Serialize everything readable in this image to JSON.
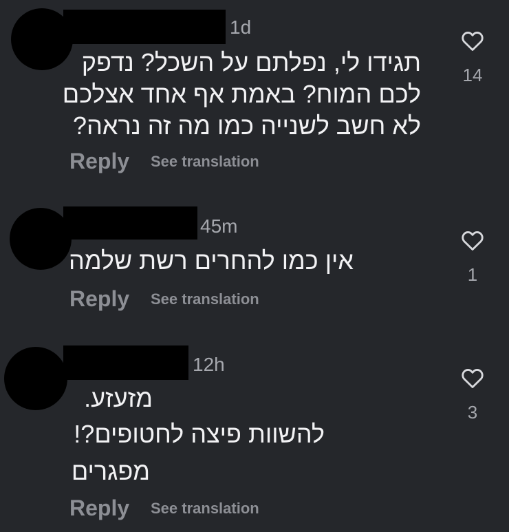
{
  "colors": {
    "background": "#25272b",
    "text": "#f2f2f4",
    "muted": "#8d8f95",
    "redaction": "#000000"
  },
  "comments": [
    {
      "time": "1d",
      "lines": [
        "תגידו לי, נפלתם על השכל? נדפק",
        "לכם המוח? באמת אף אחד אצלכם",
        "לא חשב לשנייה כמו מה זה נראה?"
      ],
      "reply": "Reply",
      "translate": "See translation",
      "likes": "14"
    },
    {
      "time": "45m",
      "lines": [
        "אין כמו להחרים רשת שלמה"
      ],
      "reply": "Reply",
      "translate": "See translation",
      "likes": "1"
    },
    {
      "time": "12h",
      "lines": [
        "מזעזע.",
        "להשוות פיצה לחטופים?!",
        "מפגרים"
      ],
      "reply": "Reply",
      "translate": "See translation",
      "likes": "3"
    }
  ],
  "icons": {
    "like": "heart-outline-icon"
  }
}
